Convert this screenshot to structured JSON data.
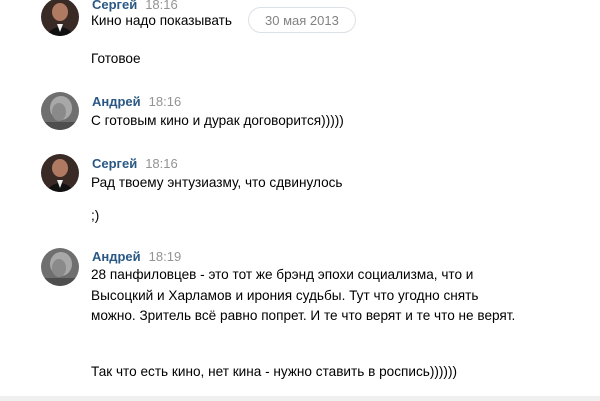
{
  "date_divider": "30 мая 2013",
  "messages": [
    {
      "author": "Сергей",
      "time": "18:16",
      "paragraphs": [
        "Кино надо показывать",
        "Готовое"
      ]
    },
    {
      "author": "Андрей",
      "time": "18:16",
      "paragraphs": [
        "С готовым кино и дурак договорится)))))"
      ]
    },
    {
      "author": "Сергей",
      "time": "18:16",
      "paragraphs": [
        "Рад твоему энтузиазму, что сдвинулось",
        ";)"
      ]
    },
    {
      "author": "Андрей",
      "time": "18:19",
      "paragraphs": [
        "28 панфиловцев - это тот же брэнд эпохи социализма, что и Высоцкий и Харламов и ирония судьбы. Тут что угодно снять можно. Зритель всё равно попрет. И те что верят и те что не верят.",
        "Так что есть кино, нет кина - нужно ставить в роспись))))))"
      ]
    }
  ],
  "colors": {
    "author_link": "#2a5885",
    "timestamp": "#939393",
    "text": "#000000"
  }
}
